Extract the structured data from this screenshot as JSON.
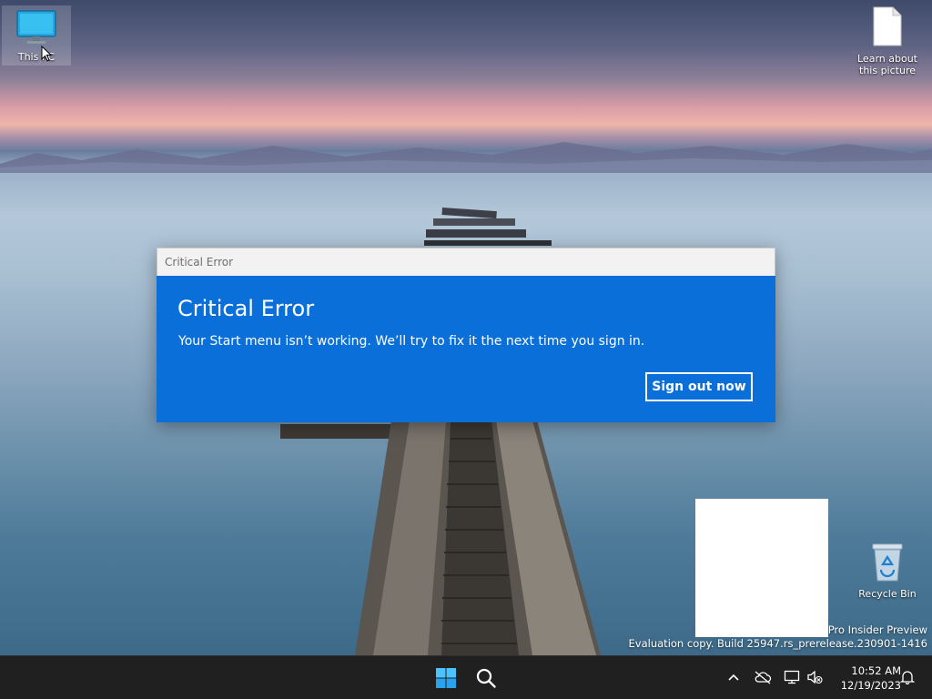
{
  "desktop": {
    "icons": [
      {
        "label": "This PC"
      },
      {
        "label": "Learn about this picture"
      },
      {
        "label": "Recycle Bin"
      }
    ]
  },
  "dialog": {
    "window_title": "Critical Error",
    "heading": "Critical Error",
    "message": "Your Start menu isn’t working. We’ll try to fix it the next time you sign in.",
    "button_label": "Sign out now",
    "accent_color": "#0a6fd8"
  },
  "watermark": {
    "line1": "Windows 11 Pro Insider Preview",
    "line2": "Evaluation copy. Build 25947.rs_prerelease.230901-1416"
  },
  "taskbar": {
    "clock_time": "10:52 AM",
    "clock_date": "12/19/2023",
    "tray_icons": [
      "chevron-up-icon",
      "cloud-offline-icon",
      "network-icon",
      "volume-muted-icon",
      "notification-bell-icon"
    ]
  }
}
